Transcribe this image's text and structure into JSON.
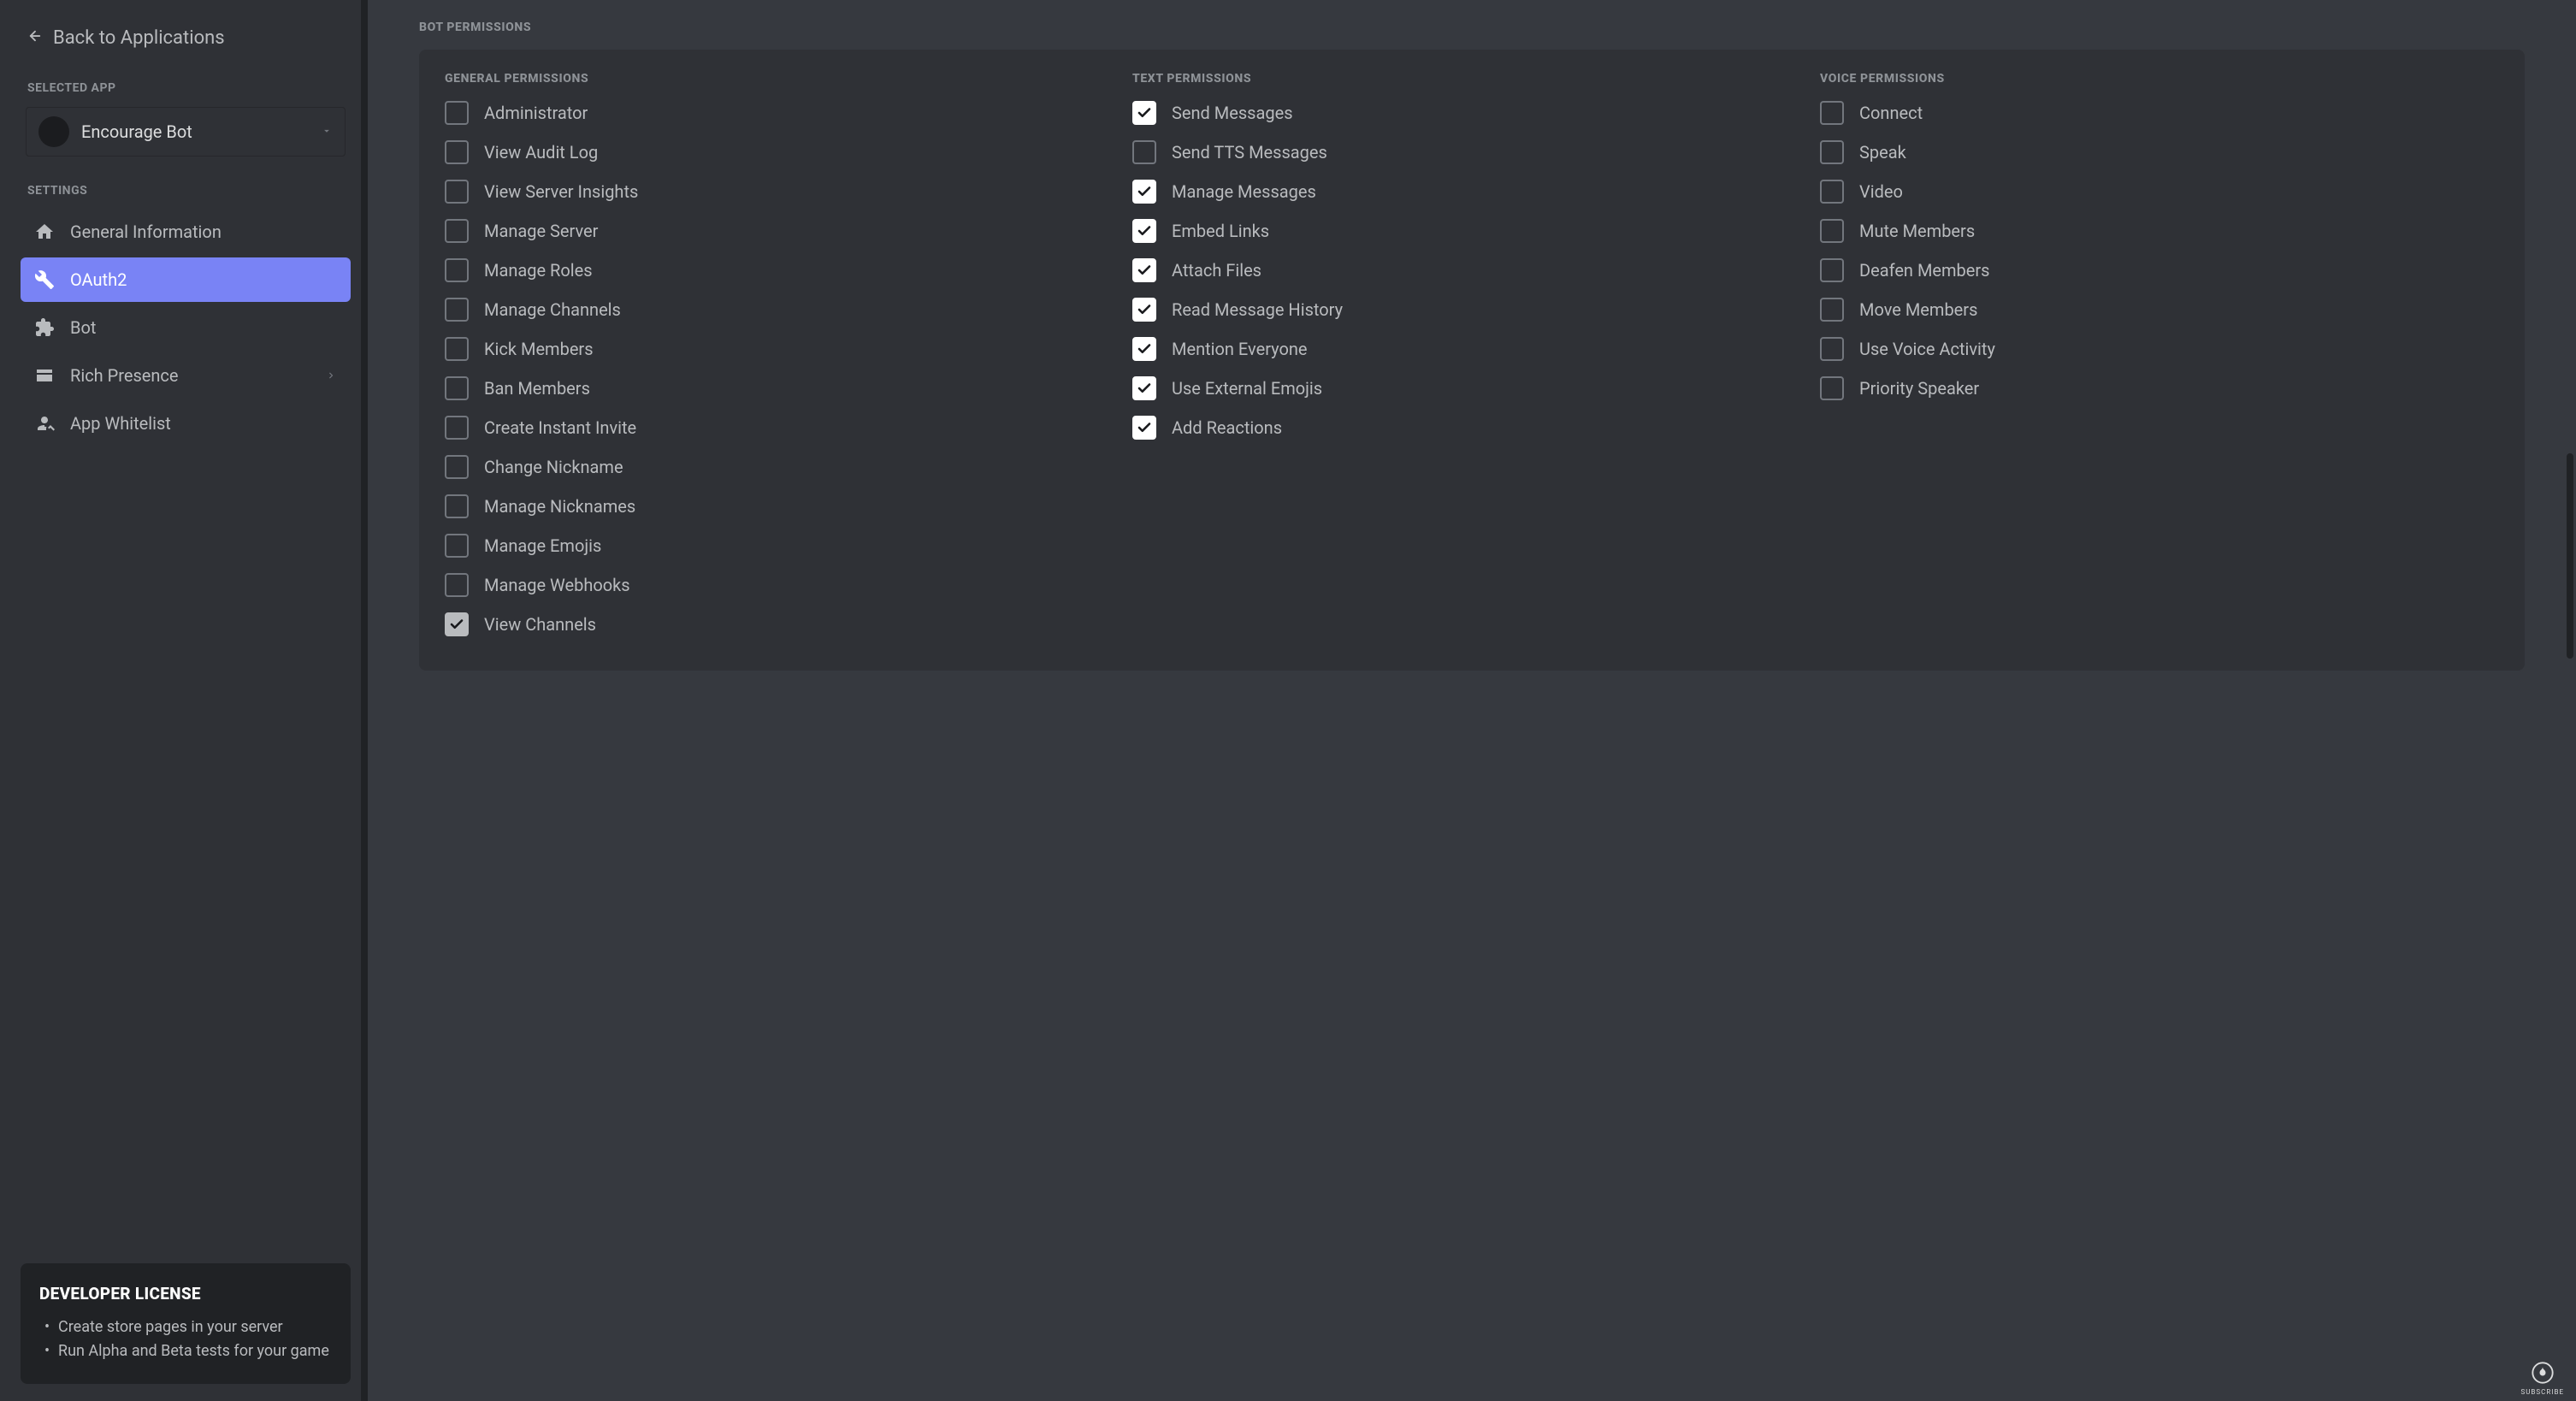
{
  "sidebar": {
    "back_label": "Back to Applications",
    "selected_app_label": "SELECTED APP",
    "selected_app_name": "Encourage Bot",
    "settings_label": "SETTINGS",
    "nav": [
      {
        "id": "general",
        "label": "General Information",
        "active": false,
        "expandable": false
      },
      {
        "id": "oauth2",
        "label": "OAuth2",
        "active": true,
        "expandable": false
      },
      {
        "id": "bot",
        "label": "Bot",
        "active": false,
        "expandable": false
      },
      {
        "id": "rich",
        "label": "Rich Presence",
        "active": false,
        "expandable": true
      },
      {
        "id": "whitelist",
        "label": "App Whitelist",
        "active": false,
        "expandable": false
      }
    ],
    "dev_card": {
      "title": "DEVELOPER LICENSE",
      "bullets": [
        "Create store pages in your server",
        "Run Alpha and Beta tests for your game"
      ]
    }
  },
  "main": {
    "section_title": "BOT PERMISSIONS",
    "columns": [
      {
        "title": "GENERAL PERMISSIONS",
        "items": [
          {
            "label": "Administrator",
            "checked": false
          },
          {
            "label": "View Audit Log",
            "checked": false
          },
          {
            "label": "View Server Insights",
            "checked": false
          },
          {
            "label": "Manage Server",
            "checked": false
          },
          {
            "label": "Manage Roles",
            "checked": false
          },
          {
            "label": "Manage Channels",
            "checked": false
          },
          {
            "label": "Kick Members",
            "checked": false
          },
          {
            "label": "Ban Members",
            "checked": false
          },
          {
            "label": "Create Instant Invite",
            "checked": false
          },
          {
            "label": "Change Nickname",
            "checked": false
          },
          {
            "label": "Manage Nicknames",
            "checked": false
          },
          {
            "label": "Manage Emojis",
            "checked": false
          },
          {
            "label": "Manage Webhooks",
            "checked": false
          },
          {
            "label": "View Channels",
            "checked": true,
            "muted": true
          }
        ]
      },
      {
        "title": "TEXT PERMISSIONS",
        "items": [
          {
            "label": "Send Messages",
            "checked": true
          },
          {
            "label": "Send TTS Messages",
            "checked": false
          },
          {
            "label": "Manage Messages",
            "checked": true
          },
          {
            "label": "Embed Links",
            "checked": true
          },
          {
            "label": "Attach Files",
            "checked": true
          },
          {
            "label": "Read Message History",
            "checked": true
          },
          {
            "label": "Mention Everyone",
            "checked": true
          },
          {
            "label": "Use External Emojis",
            "checked": true
          },
          {
            "label": "Add Reactions",
            "checked": true
          }
        ]
      },
      {
        "title": "VOICE PERMISSIONS",
        "items": [
          {
            "label": "Connect",
            "checked": false
          },
          {
            "label": "Speak",
            "checked": false
          },
          {
            "label": "Video",
            "checked": false
          },
          {
            "label": "Mute Members",
            "checked": false
          },
          {
            "label": "Deafen Members",
            "checked": false
          },
          {
            "label": "Move Members",
            "checked": false
          },
          {
            "label": "Use Voice Activity",
            "checked": false
          },
          {
            "label": "Priority Speaker",
            "checked": false
          }
        ]
      }
    ]
  },
  "subscribe_label": "SUBSCRIBE"
}
